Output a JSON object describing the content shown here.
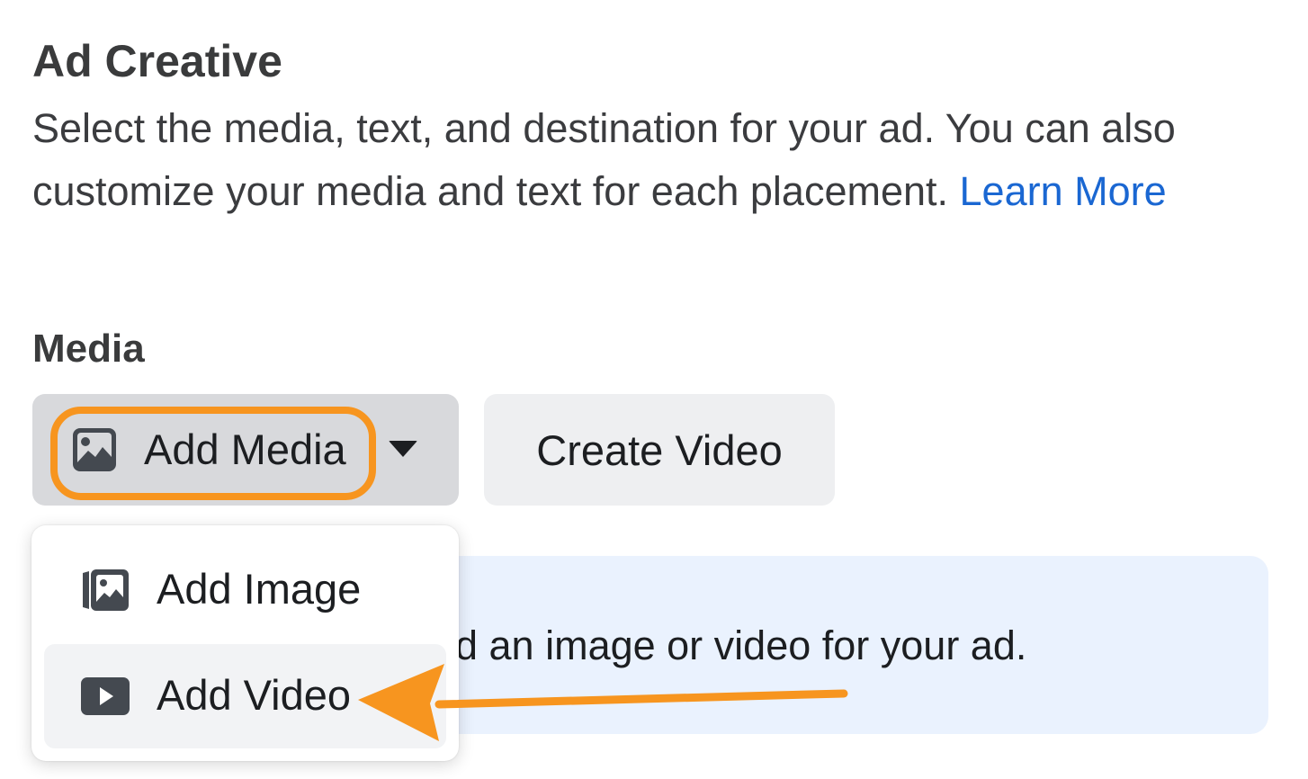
{
  "header": {
    "title": "Ad Creative",
    "description": "Select the media, text, and destination for your ad. You can also customize your media and text for each placement.",
    "learn_more": "Learn More"
  },
  "media": {
    "label": "Media",
    "add_media_label": "Add Media",
    "create_video_label": "Create Video",
    "info_text": "d an image or video for your ad."
  },
  "dropdown": {
    "items": [
      {
        "label": "Add Image",
        "icon": "image-stack-icon"
      },
      {
        "label": "Add Video",
        "icon": "video-play-icon"
      }
    ]
  },
  "colors": {
    "highlight": "#f7951f",
    "link": "#1a67d2",
    "banner": "#eaf2fe"
  }
}
